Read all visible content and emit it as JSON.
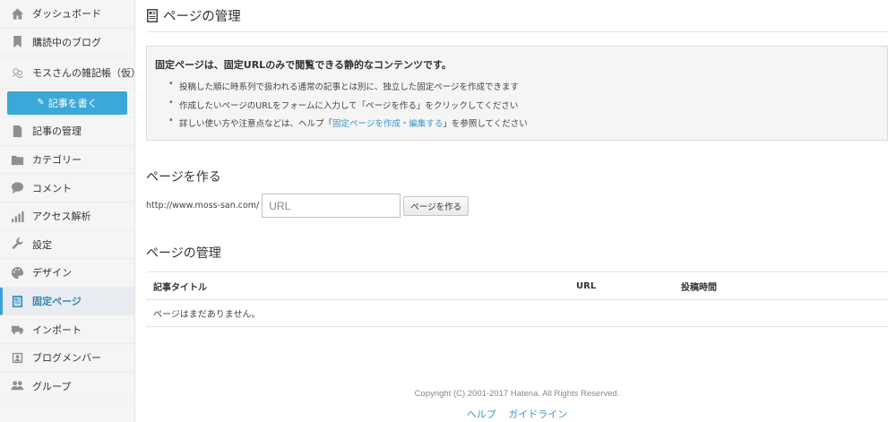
{
  "sidebar": {
    "items": [
      {
        "label": "ダッシュボード",
        "icon": "home-icon"
      },
      {
        "label": "購読中のブログ",
        "icon": "bookmark-icon"
      },
      {
        "label": "モスさんの雑記帳（仮）",
        "icon": "blog-avatar-icon"
      },
      {
        "label": "記事の管理",
        "icon": "document-icon"
      },
      {
        "label": "カテゴリー",
        "icon": "folder-icon"
      },
      {
        "label": "コメント",
        "icon": "comment-icon"
      },
      {
        "label": "アクセス解析",
        "icon": "bar-chart-icon"
      },
      {
        "label": "設定",
        "icon": "wrench-icon"
      },
      {
        "label": "デザイン",
        "icon": "palette-icon"
      },
      {
        "label": "固定ページ",
        "icon": "page-icon"
      },
      {
        "label": "インポート",
        "icon": "truck-icon"
      },
      {
        "label": "ブログメンバー",
        "icon": "member-icon"
      },
      {
        "label": "グループ",
        "icon": "group-icon"
      }
    ],
    "write_button": "記事を書く",
    "active_item": "固定ページ"
  },
  "header": {
    "title": "ページの管理"
  },
  "info": {
    "heading": "固定ページは、固定URLのみで閲覧できる静的なコンテンツです。",
    "bullet1": "投稿した順に時系列で扱われる通常の記事とは別に、独立した固定ページを作成できます",
    "bullet2": "作成したいページのURLをフォームに入力して「ページを作る」をクリックしてください",
    "bullet3_pre": "詳しい使い方や注意点などは、ヘルプ「",
    "bullet3_link": "固定ページを作成・編集する",
    "bullet3_post": "」を参照してください"
  },
  "create": {
    "title": "ページを作る",
    "prefix": "http://www.moss-san.com/",
    "placeholder": "URL",
    "button": "ページを作る"
  },
  "manage": {
    "title": "ページの管理",
    "columns": [
      "記事タイトル",
      "URL",
      "投稿時間"
    ],
    "empty": "ページはまだありません。"
  },
  "footer": {
    "copyright": "Copyright (C) 2001-2017 Hatena. All Rights Reserved.",
    "help": "ヘルプ",
    "guideline": "ガイドライン"
  },
  "colors": {
    "accent": "#3aa8d8",
    "link": "#3a97c9",
    "sidebar_bg": "#f5f5f5"
  }
}
